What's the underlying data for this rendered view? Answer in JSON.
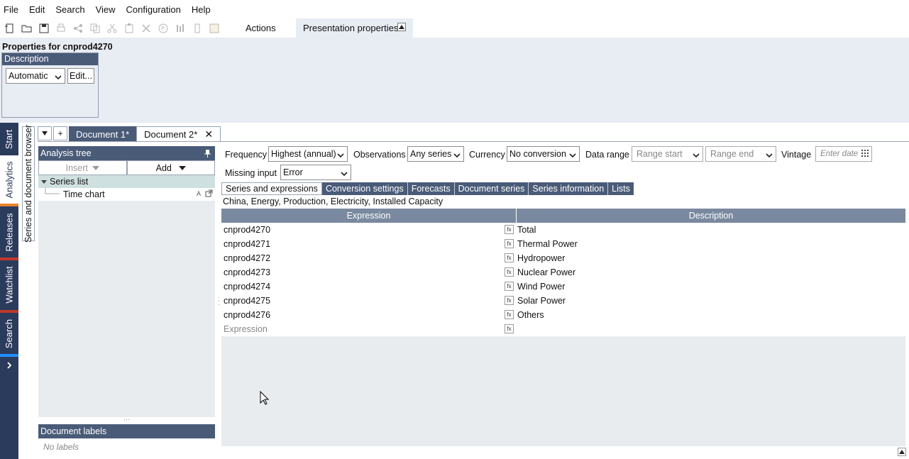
{
  "menu": [
    "File",
    "Edit",
    "Search",
    "View",
    "Configuration",
    "Help"
  ],
  "toolbar": {
    "icons": [
      "new-document-icon",
      "open-icon",
      "save-icon",
      "print-icon",
      "share-icon",
      "copy-icon",
      "cut-icon",
      "paste-icon",
      "delete-icon",
      "p-icon",
      "chart-icon",
      "dashboard-icon",
      "image-icon"
    ],
    "actions_label": "Actions",
    "presentation_tab": "Presentation properties"
  },
  "properties": {
    "title": "Properties for cnprod4270",
    "description_header": "Description",
    "description_mode": "Automatic",
    "edit_button": "Edit..."
  },
  "left_tabs": [
    "Start",
    "Analytics",
    "Releases",
    "Watchlist",
    "Search"
  ],
  "series_browser_tab": "Series and document browser",
  "doc_tabs": {
    "add_label": "+",
    "tabs": [
      {
        "label": "Document 1*"
      },
      {
        "label": "Document 2*"
      }
    ]
  },
  "analysis_tree": {
    "title": "Analysis tree",
    "insert_label": "Insert",
    "add_label": "Add",
    "items": [
      {
        "label": "Series list"
      },
      {
        "label": "Time chart",
        "badge": "A"
      }
    ]
  },
  "document_labels": {
    "title": "Document labels",
    "empty": "No labels"
  },
  "controls": {
    "frequency_label": "Frequency",
    "frequency_value": "Highest (annual)",
    "observations_label": "Observations",
    "observations_value": "Any series",
    "currency_label": "Currency",
    "currency_value": "No conversion",
    "data_range_label": "Data range",
    "range_start": "Range start",
    "range_end": "Range end",
    "vintage_label": "Vintage",
    "vintage_placeholder": "Enter date",
    "missing_input_label": "Missing input",
    "missing_input_value": "Error"
  },
  "subtabs": [
    "Series and expressions",
    "Conversion settings",
    "Forecasts",
    "Document series",
    "Series information",
    "Lists"
  ],
  "keywords": "China, Energy, Production, Electricity, Installed Capacity",
  "grid": {
    "col_expression": "Expression",
    "col_description": "Description",
    "rows": [
      {
        "expr": "cnprod4270",
        "desc": "Total"
      },
      {
        "expr": "cnprod4271",
        "desc": "Thermal Power"
      },
      {
        "expr": "cnprod4272",
        "desc": "Hydropower"
      },
      {
        "expr": "cnprod4273",
        "desc": "Nuclear Power"
      },
      {
        "expr": "cnprod4274",
        "desc": "Wind Power"
      },
      {
        "expr": "cnprod4275",
        "desc": "Solar Power"
      },
      {
        "expr": "cnprod4276",
        "desc": "Others"
      }
    ],
    "placeholder": "Expression"
  },
  "colors": {
    "header_dark": "#4a5b78",
    "strip": "#2b3b5c",
    "panel_bg": "#e8ecf3",
    "accent_analytics": "#e8822a",
    "accent_releases": "#c0392b",
    "accent_watchlist": "#c0392b",
    "accent_search": "#1e90ff"
  }
}
